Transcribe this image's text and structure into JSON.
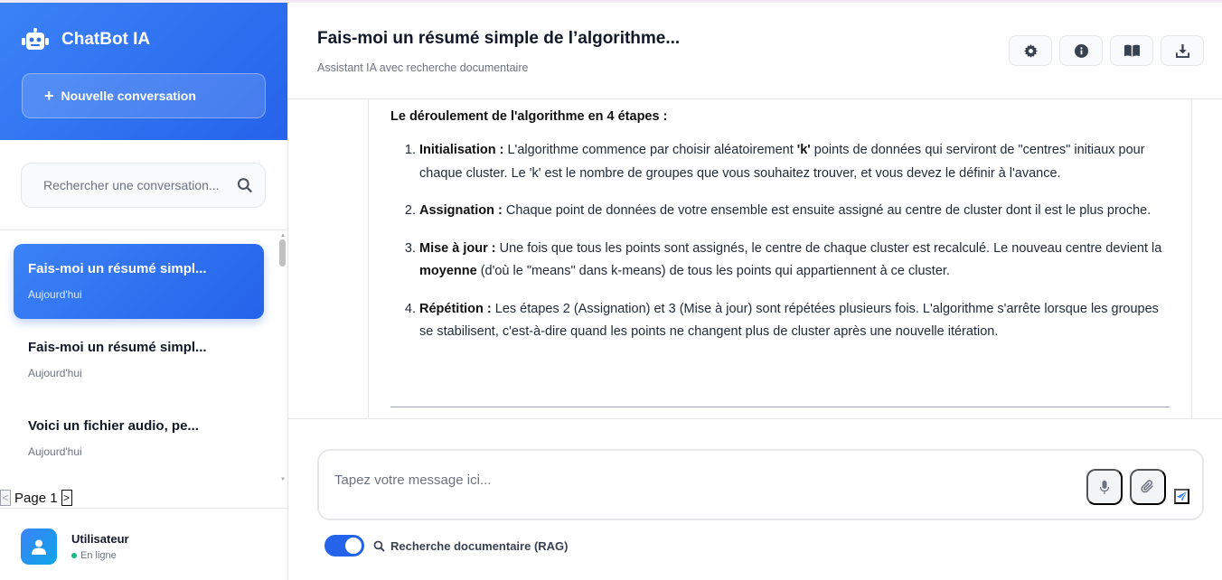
{
  "sidebar": {
    "brand_title": "ChatBot IA",
    "new_conversation_label": "Nouvelle conversation",
    "search_placeholder": "Rechercher une conversation...",
    "conversations": [
      {
        "title": "Fais-moi un résumé simpl...",
        "date": "Aujourd'hui",
        "active": true
      },
      {
        "title": "Fais-moi un résumé simpl...",
        "date": "Aujourd'hui",
        "active": false
      },
      {
        "title": "Voici un fichier audio, pe...",
        "date": "Aujourd'hui",
        "active": false
      }
    ],
    "pager_label": "Page 1",
    "pager_prev": "<",
    "pager_next": ">",
    "user": {
      "name": "Utilisateur",
      "status": "En ligne"
    }
  },
  "header": {
    "title": "Fais-moi un résumé simple de l’algorithme...",
    "subtitle": "Assistant IA avec recherche documentaire",
    "buttons": [
      "gear-icon",
      "info-icon",
      "book-icon",
      "download-icon"
    ]
  },
  "message": {
    "heading": "Le déroulement de l'algorithme en 4 étapes :",
    "steps": [
      {
        "term": "Initialisation :",
        "text_a": " L'algorithme commence par choisir aléatoirement ",
        "bold_mid": "'k'",
        "text_b": " points de données qui serviront de \"centres\" initiaux pour chaque cluster. Le 'k' est le nombre de groupes que vous souhaitez trouver, et vous devez le définir à l'avance."
      },
      {
        "term": "Assignation :",
        "text_a": " Chaque point de données de votre ensemble est ensuite assigné au centre de cluster dont il est le plus proche.",
        "bold_mid": "",
        "text_b": ""
      },
      {
        "term": "Mise à jour :",
        "text_a": " Une fois que tous les points sont assignés, le centre de chaque cluster est recalculé. Le nouveau centre devient la ",
        "bold_mid": "moyenne",
        "text_b": " (d'où le \"means\" dans k-means) de tous les points qui appartiennent à ce cluster."
      },
      {
        "term": "Répétition :",
        "text_a": " Les étapes 2 (Assignation) et 3 (Mise à jour) sont répétées plusieurs fois. L'algorithme s'arrête lorsque les groupes se stabilisent, c'est-à-dire quand les points ne changent plus de cluster après une nouvelle itération.",
        "bold_mid": "",
        "text_b": ""
      }
    ]
  },
  "composer": {
    "placeholder": "Tapez votre message ici...",
    "rag_label": "Recherche documentaire (RAG)",
    "rag_enabled": true
  },
  "colors": {
    "accent": "#2563eb",
    "accent_light": "#3b82f6",
    "online": "#10b981"
  }
}
